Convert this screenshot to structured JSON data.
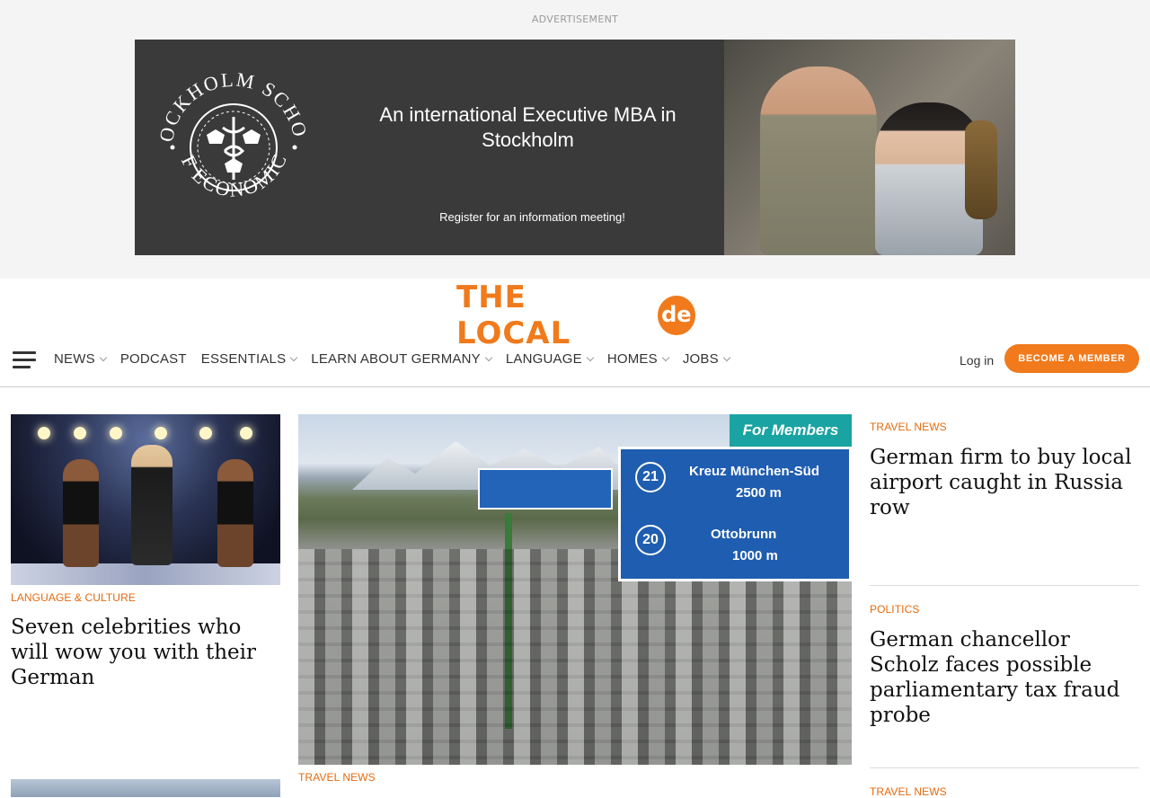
{
  "ad": {
    "label": "ADVERTISEMENT",
    "seal_top_text": "STOCKHOLM SCHOOL",
    "seal_bottom_text": "OF ECONOMICS",
    "headline": "An international Executive MBA in Stockholm",
    "cta": "Register for an information meeting!"
  },
  "brand": {
    "logo_text": "THE LOCAL",
    "logo_badge": "de",
    "accent_color": "#f07a1c",
    "members_color": "#1aa3a3"
  },
  "nav": {
    "items": [
      {
        "label": "NEWS",
        "has_dropdown": true
      },
      {
        "label": "PODCAST",
        "has_dropdown": false
      },
      {
        "label": "ESSENTIALS",
        "has_dropdown": true
      },
      {
        "label": "LEARN ABOUT GERMANY",
        "has_dropdown": true
      },
      {
        "label": "LANGUAGE",
        "has_dropdown": true
      },
      {
        "label": "HOMES",
        "has_dropdown": true
      },
      {
        "label": "JOBS",
        "has_dropdown": true
      }
    ],
    "login": "Log in",
    "become_member": "BECOME A MEMBER"
  },
  "left_article": {
    "category": "LANGUAGE & CULTURE",
    "headline": "Seven celebrities who will wow you with their German"
  },
  "main_article": {
    "badge": "For Members",
    "category": "TRAVEL NEWS",
    "sign": {
      "number_1": "21",
      "dest_1": "Kreuz München-Süd",
      "dist_1": "2500 m",
      "number_2": "20",
      "dest_2": "Ottobrunn",
      "dist_2": "1000 m"
    }
  },
  "right_articles": [
    {
      "category": "TRAVEL NEWS",
      "headline": "German firm to buy local airport caught in Russia row"
    },
    {
      "category": "POLITICS",
      "headline": "German chancellor Scholz faces possible parliamentary tax fraud probe"
    },
    {
      "category": "TRAVEL NEWS",
      "headline": ""
    }
  ]
}
